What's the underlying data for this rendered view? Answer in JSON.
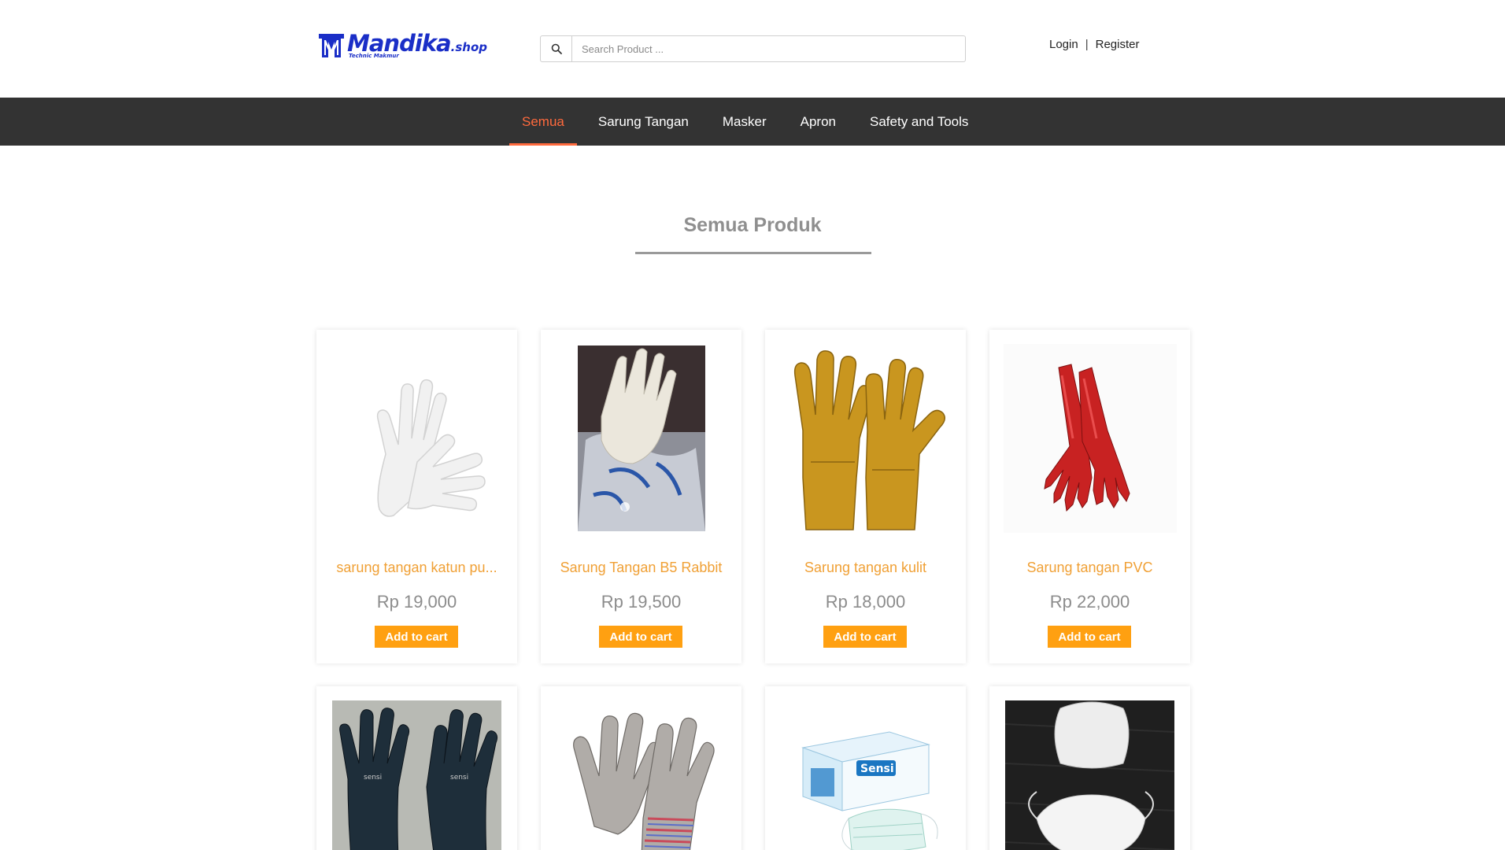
{
  "brand": {
    "name": "Mandika",
    "suffix": ".shop",
    "tagline": "Technic Makmur"
  },
  "search": {
    "placeholder": "Search Product ..."
  },
  "auth": {
    "login": "Login",
    "separator": "|",
    "register": "Register"
  },
  "nav": {
    "items": [
      {
        "label": "Semua",
        "active": true
      },
      {
        "label": "Sarung Tangan",
        "active": false
      },
      {
        "label": "Masker",
        "active": false
      },
      {
        "label": "Apron",
        "active": false
      },
      {
        "label": "Safety and Tools",
        "active": false
      }
    ]
  },
  "section": {
    "title": "Semua Produk"
  },
  "products": [
    {
      "name": "sarung tangan katun pu...",
      "price": "Rp 19,000",
      "cart": "Add to cart",
      "icon": "white-cotton-glove-image"
    },
    {
      "name": "Sarung Tangan B5 Rabbit",
      "price": "Rp 19,500",
      "cart": "Add to cart",
      "icon": "knit-glove-photo"
    },
    {
      "name": "Sarung tangan kulit",
      "price": "Rp 18,000",
      "cart": "Add to cart",
      "icon": "leather-welding-glove-image"
    },
    {
      "name": "Sarung tangan PVC",
      "price": "Rp 22,000",
      "cart": "Add to cart",
      "icon": "red-pvc-glove-image"
    },
    {
      "icon": "black-nitrile-glove-photo"
    },
    {
      "icon": "leather-work-glove-image"
    },
    {
      "icon": "sensi-mask-box-image"
    },
    {
      "icon": "white-n95-mask-photo"
    }
  ],
  "colors": {
    "accent": "#ff6a3d",
    "price_name": "#f0a035",
    "cart_button": "#ffa011",
    "nav_bg": "#333333",
    "brand_blue": "#1a2ec7"
  }
}
